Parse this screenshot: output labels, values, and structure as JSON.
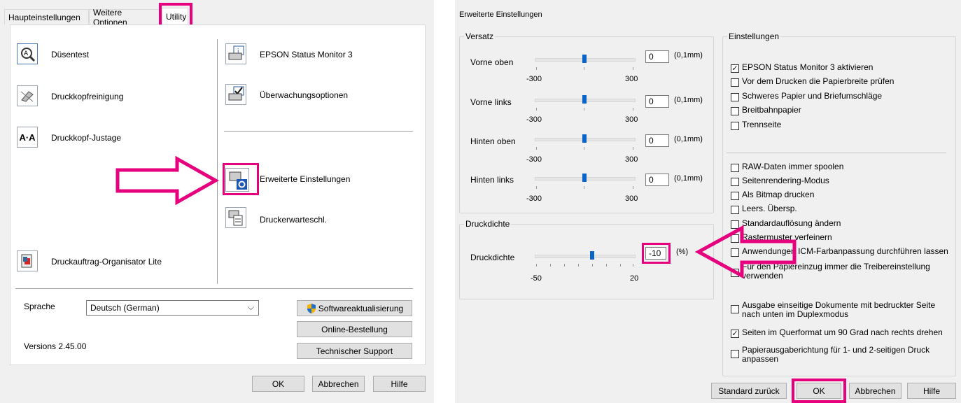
{
  "left": {
    "tabs": [
      "Haupteinstellungen",
      "Weitere Optionen",
      "Utility"
    ],
    "items_left": [
      "Düsentest",
      "Druckkopfreinigung",
      "Druckkopf-Justage",
      "Druckauftrag-Organisator Lite"
    ],
    "items_right": [
      "EPSON Status Monitor 3",
      "Überwachungsoptionen",
      "Erweiterte Einstellungen",
      "Druckerwarteschl."
    ],
    "language_label": "Sprache",
    "language_value": "Deutsch (German)",
    "version": "Versions 2.45.00",
    "buttons": {
      "software_update": "Softwareaktualisierung",
      "online_order": "Online-Bestellung",
      "tech_support": "Technischer Support",
      "ok": "OK",
      "cancel": "Abbrechen",
      "help": "Hilfe"
    }
  },
  "right": {
    "title": "Erweiterte Einstellungen",
    "versatz": {
      "title": "Versatz",
      "rows": [
        {
          "label": "Vorne oben",
          "value": "0",
          "unit": "(0,1mm)",
          "min": "-300",
          "max": "300"
        },
        {
          "label": "Vorne links",
          "value": "0",
          "unit": "(0,1mm)",
          "min": "-300",
          "max": "300"
        },
        {
          "label": "Hinten oben",
          "value": "0",
          "unit": "(0,1mm)",
          "min": "-300",
          "max": "300"
        },
        {
          "label": "Hinten links",
          "value": "0",
          "unit": "(0,1mm)",
          "min": "-300",
          "max": "300"
        }
      ]
    },
    "druckdichte": {
      "title": "Druckdichte",
      "label": "Druckdichte",
      "value": "-10",
      "unit": "(%)",
      "min": "-50",
      "max": "20"
    },
    "einstellungen": {
      "title": "Einstellungen",
      "group1": [
        {
          "label": "EPSON Status Monitor 3 aktivieren",
          "checked": true
        },
        {
          "label": "Vor dem Drucken die Papierbreite prüfen",
          "checked": false
        },
        {
          "label": "Schweres Papier und Briefumschläge",
          "checked": false
        },
        {
          "label": "Breitbahnpapier",
          "checked": false
        },
        {
          "label": "Trennseite",
          "checked": false
        }
      ],
      "group2": [
        {
          "label": "RAW-Daten immer spoolen",
          "checked": false
        },
        {
          "label": "Seitenrendering-Modus",
          "checked": false
        },
        {
          "label": "Als Bitmap drucken",
          "checked": false
        },
        {
          "label": "Leers. Übersp.",
          "checked": false
        },
        {
          "label": "Standardauflösung ändern",
          "checked": false
        },
        {
          "label": "Rastermuster verfeinern",
          "checked": false
        },
        {
          "label": "Anwendungen ICM-Farbanpassung durchführen lassen",
          "checked": false
        },
        {
          "label": "Für den Papiereinzug immer die Treibereinstellung verwenden",
          "checked": false
        },
        {
          "label": "Ausgabe einseitige Dokumente mit bedruckter Seite nach unten im Duplexmodus",
          "checked": false
        },
        {
          "label": "Seiten im Querformat um 90 Grad nach rechts drehen",
          "checked": true
        },
        {
          "label": "Papierausgaberichtung für 1- und 2-seitigen Druck anpassen",
          "checked": false
        }
      ]
    },
    "buttons": {
      "reset": "Standard zurück",
      "ok": "OK",
      "cancel": "Abbrechen",
      "help": "Hilfe"
    }
  },
  "colors": {
    "highlight": "#e6007e",
    "slider_thumb": "#0a64c8",
    "dialog_bg": "#f0f0f0"
  }
}
